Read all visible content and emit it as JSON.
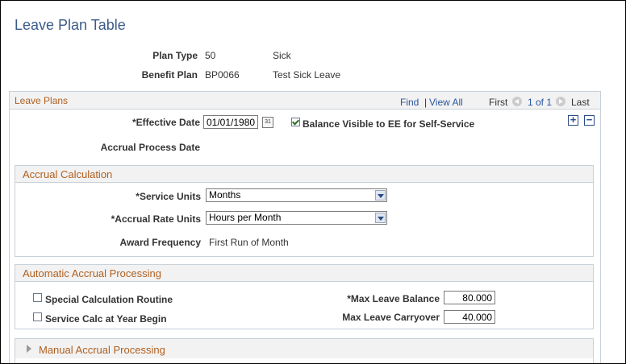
{
  "page_title": "Leave Plan Table",
  "plan_type": {
    "label": "Plan Type",
    "code": "50",
    "description": "Sick"
  },
  "benefit_plan": {
    "label": "Benefit Plan",
    "code": "BP0066",
    "description": "Test Sick Leave"
  },
  "leave_plans": {
    "title": "Leave Plans",
    "find": "Find",
    "separator": "|",
    "view_all": "View All",
    "first": "First",
    "position": "1 of 1",
    "last": "Last",
    "effective_date_label": "*Effective Date",
    "effective_date_value": "01/01/1980",
    "balance_visible_label": "Balance Visible to EE for Self-Service",
    "balance_visible_checked": true,
    "accrual_process_date_label": "Accrual Process Date",
    "add_row": "+",
    "delete_row": "−"
  },
  "accrual_calculation": {
    "title": "Accrual Calculation",
    "service_units_label": "*Service Units",
    "service_units_value": "Months",
    "accrual_rate_units_label": "*Accrual Rate Units",
    "accrual_rate_units_value": "Hours per Month",
    "award_frequency_label": "Award Frequency",
    "award_frequency_value": "First Run of Month"
  },
  "automatic_accrual": {
    "title": "Automatic Accrual Processing",
    "special_calc_label": "Special Calculation Routine",
    "special_calc_checked": false,
    "service_calc_label": "Service Calc at Year Begin",
    "service_calc_checked": false,
    "max_leave_balance_label": "*Max Leave Balance",
    "max_leave_balance_value": "80.000",
    "max_leave_carryover_label": "Max Leave Carryover",
    "max_leave_carryover_value": "40.000"
  },
  "manual_accrual": {
    "title": "Manual Accrual Processing"
  },
  "colors": {
    "title": "#3b5b8a",
    "section_title": "#b06020",
    "link": "#2a55a0"
  }
}
